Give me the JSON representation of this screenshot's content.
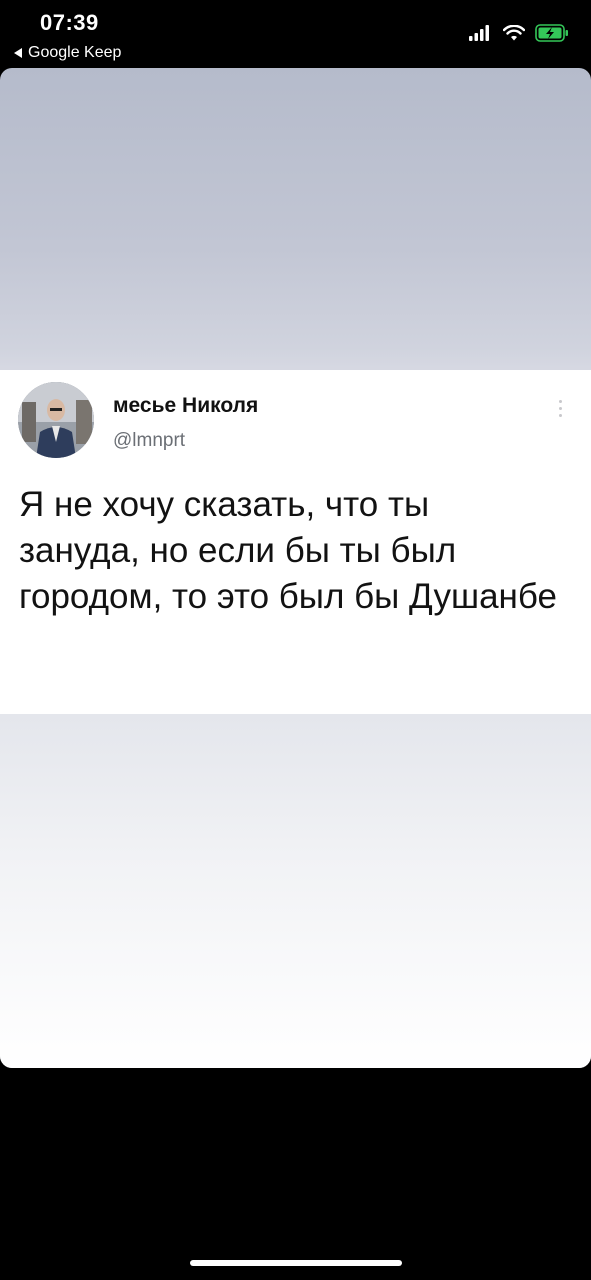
{
  "status_bar": {
    "time": "07:39",
    "back_app": "Google Keep",
    "signal_icon": "cellular-signal-icon",
    "wifi_icon": "wifi-icon",
    "battery_icon": "battery-charging-icon"
  },
  "tweet": {
    "author_name": "месье Николя",
    "author_handle": "@lmnprt",
    "text": "Я не хочу сказать, что ты зануда, но если бы ты был городом, то это был бы Душанбе",
    "more_icon": "more-options-icon"
  },
  "colors": {
    "background": "#000000",
    "card_top": "#b5bbcb",
    "tweet_background": "#ffffff",
    "text": "#121212",
    "handle": "#6b6f75",
    "battery": "#34c759"
  }
}
